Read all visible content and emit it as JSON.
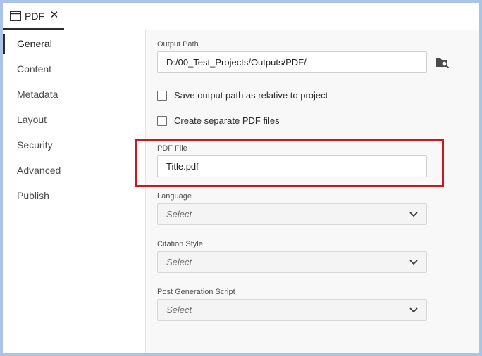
{
  "tab": {
    "label": "PDF",
    "close_glyph": "✕",
    "icon": "window-icon"
  },
  "sidebar": {
    "items": [
      {
        "label": "General",
        "active": true
      },
      {
        "label": "Content"
      },
      {
        "label": "Metadata"
      },
      {
        "label": "Layout"
      },
      {
        "label": "Security"
      },
      {
        "label": "Advanced"
      },
      {
        "label": "Publish"
      }
    ]
  },
  "general": {
    "output_path": {
      "label": "Output Path",
      "value": "D:/00_Test_Projects/Outputs/PDF/",
      "browse_icon": "folder-search-icon"
    },
    "relative_path": {
      "label": "Save output path as relative to project",
      "checked": false
    },
    "separate_files": {
      "label": "Create separate PDF files",
      "checked": false
    },
    "pdf_file": {
      "label": "PDF File",
      "value": "Title.pdf"
    },
    "language": {
      "label": "Language",
      "value": "Select"
    },
    "citation_style": {
      "label": "Citation Style",
      "value": "Select"
    },
    "post_script": {
      "label": "Post Generation Script",
      "value": "Select"
    }
  },
  "colors": {
    "highlight": "#c8191f",
    "frame": "#a9c4e6"
  }
}
